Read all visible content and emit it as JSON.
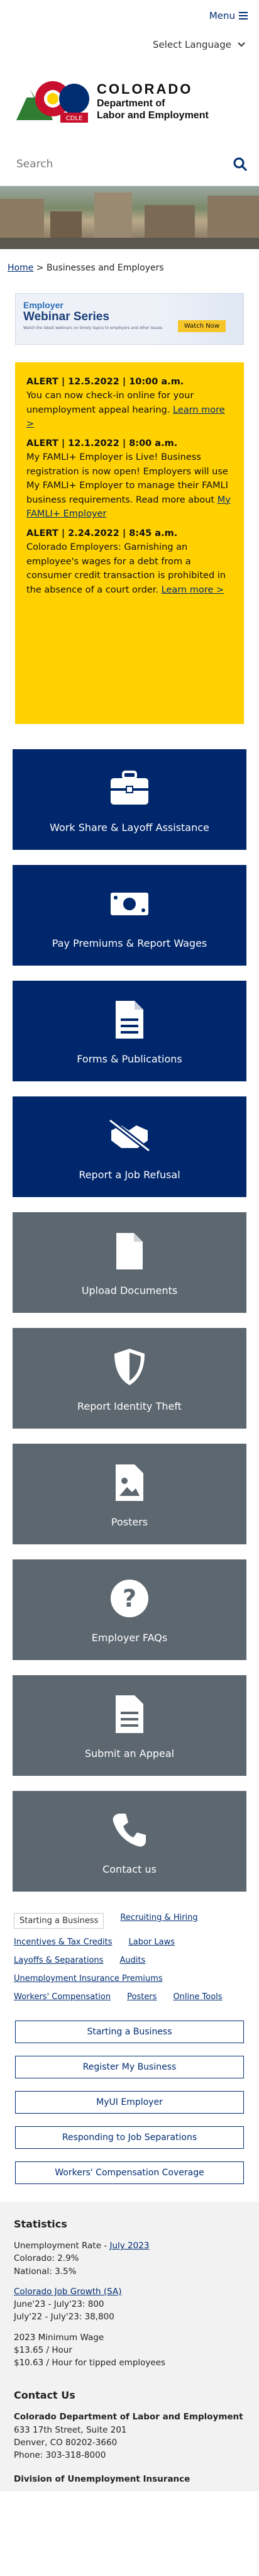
{
  "header": {
    "menu_label": "Menu",
    "language_label": "Select Language",
    "logo_badge": "CDLE",
    "logo_state": "COLORADO",
    "logo_line2": "Department of",
    "logo_line3": "Labor and Employment",
    "search_placeholder": "Search"
  },
  "breadcrumb": {
    "home": "Home",
    "sep": ">",
    "current": "Businesses and Employers"
  },
  "banner": {
    "line1": "Employer",
    "line2": "Webinar Series",
    "line3": "Watch the latest webinars on timely topics to employers and other issues",
    "cta": "Watch Now"
  },
  "alerts": [
    {
      "heading": "ALERT | 12.5.2022 | 10:00 a.m.",
      "body": "You can now check-in online for your unemployment appeal hearing.",
      "link": "Learn more >"
    },
    {
      "heading": "ALERT | 12.1.2022 | 8:00 a.m.",
      "body": "My FAMLI+ Employer is Live! Business registration is now open! Employers will use My FAMLI+ Employer to manage their FAMLI business requirements. Read more about",
      "link": "My FAMLI+ Employer"
    },
    {
      "heading": "ALERT | 2.24.2022 | 8:45 a.m.",
      "body": "Colorado Employers: Garnishing an employee's wages for a debt from a consumer credit transaction is prohibited in the absence of a court order.",
      "link": "Learn more >"
    }
  ],
  "tiles": [
    {
      "label": "Work Share & Layoff Assistance",
      "icon": "briefcase-icon"
    },
    {
      "label": "Pay Premiums & Report Wages",
      "icon": "money-icon"
    },
    {
      "label": "Forms & Publications",
      "icon": "document-icon"
    },
    {
      "label": "Report a Job Refusal",
      "icon": "no-handshake-icon"
    },
    {
      "label": "Upload Documents",
      "icon": "file-icon"
    },
    {
      "label": "Report Identity Theft",
      "icon": "shield-icon"
    },
    {
      "label": "Posters",
      "icon": "image-icon"
    },
    {
      "label": "Employer FAQs",
      "icon": "question-icon"
    },
    {
      "label": "Submit an Appeal",
      "icon": "document-lines-icon"
    },
    {
      "label": "Contact us",
      "icon": "phone-icon"
    }
  ],
  "tabs": [
    "Starting a Business",
    "Recruiting & Hiring",
    "Incentives & Tax Credits",
    "Labor Laws",
    "Layoffs & Separations",
    "Audits",
    "Unemployment Insurance Premiums",
    "Workers' Compensation",
    "Posters",
    "Online Tools"
  ],
  "buttons": [
    "Starting a Business",
    "Register My Business",
    "MyUI Employer",
    "Responding to Job Separations",
    "Workers' Compensation Coverage"
  ],
  "footer": {
    "stats_title": "Statistics",
    "unemp_label": "Unemployment Rate -",
    "unemp_month": "July 2023",
    "co_rate": "Colorado: 2.9%",
    "nat_rate": "National: 3.5%",
    "job_growth": "Colorado Job Growth (SA)",
    "jg1": "June'23 - July'23: 800",
    "jg2": "July'22 - July'23: 38,800",
    "minwage_title": "2023 Minimum Wage",
    "mw1": "$13.65 / Hour",
    "mw2": "$10.63 / Hour for tipped employees",
    "contact_title": "Contact Us",
    "org1": "Colorado Department of Labor and Employment",
    "addr1": "633 17th Street, Suite 201",
    "addr2": "Denver, CO  80202-3660",
    "phone": "Phone: 303-318-8000",
    "div": "Division of Unemployment Insurance"
  },
  "colors": {
    "navy": "#00266b",
    "gray_tile": "#5d6770",
    "alert_yellow": "#ffd100"
  }
}
